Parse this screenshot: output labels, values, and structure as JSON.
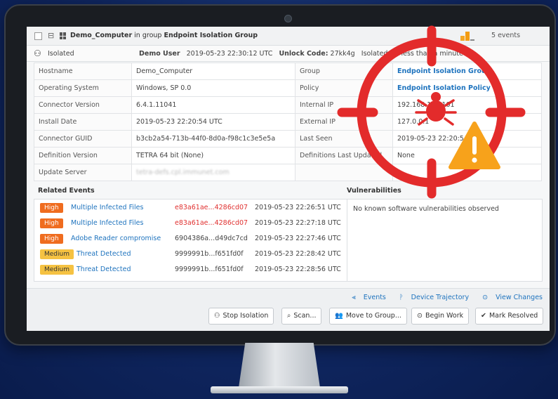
{
  "titlebar": {
    "computer_name": "Demo_Computer",
    "in_group_text": "in group",
    "group_name": "Endpoint Isolation Group",
    "events_count": "5 events"
  },
  "status": {
    "isolated_label": "Isolated",
    "user": "Demo User",
    "timestamp": "2019-05-23 22:30:12 UTC",
    "unlock_label": "Unlock Code:",
    "unlock_code": "27kk4g",
    "isolated_for": "Isolated for less than a minute"
  },
  "info_rows": [
    {
      "label": "Hostname",
      "value": "Demo_Computer",
      "label2": "Group",
      "value2": "Endpoint Isolation Group"
    },
    {
      "label": "Operating System",
      "value": "Windows, SP 0.0",
      "label2": "Policy",
      "value2": "Endpoint Isolation Policy"
    },
    {
      "label": "Connector Version",
      "value": "6.4.1.11041",
      "label2": "Internal IP",
      "value2": "192.168.100.101"
    },
    {
      "label": "Install Date",
      "value": "2019-05-23 22:20:54 UTC",
      "label2": "External IP",
      "value2": "127.0.0.1"
    },
    {
      "label": "Connector GUID",
      "value": "b3cb2a54-713b-44f0-8d0a-f98c1c3e5e5a",
      "label2": "Last Seen",
      "value2": "2019-05-23 22:20:54 UTC"
    },
    {
      "label": "Definition Version",
      "value": "TETRA 64 bit (None)",
      "label2": "Definitions Last Updated",
      "value2": "None"
    },
    {
      "label": "Update Server",
      "value": "tetra-defs.cpl.immunet.com",
      "label2": "",
      "value2": ""
    }
  ],
  "related_events": {
    "title": "Related Events",
    "rows": [
      {
        "severity": "High",
        "name": "Multiple Infected Files",
        "hash": "e83a61ae...4286cd07",
        "time": "2019-05-23 22:26:51 UTC"
      },
      {
        "severity": "High",
        "name": "Multiple Infected Files",
        "hash": "e83a61ae...4286cd07",
        "time": "2019-05-23 22:27:18 UTC"
      },
      {
        "severity": "High",
        "name": "Adobe Reader compromise",
        "hash": "6904386a...d49dc7cd",
        "time": "2019-05-23 22:27:46 UTC"
      },
      {
        "severity": "Medium",
        "name": "Threat Detected",
        "hash": "9999991b...f651fd0f",
        "time": "2019-05-23 22:28:42 UTC"
      },
      {
        "severity": "Medium",
        "name": "Threat Detected",
        "hash": "9999991b...f651fd0f",
        "time": "2019-05-23 22:28:56 UTC"
      }
    ]
  },
  "vulnerabilities": {
    "title": "Vulnerabilities",
    "message": "No known software vulnerabilities observed"
  },
  "footer_links": {
    "events": "Events",
    "trajectory": "Device Trajectory",
    "changes": "View Changes"
  },
  "buttons": {
    "stop_isolation": "Stop Isolation",
    "scan": "Scan...",
    "move_to_group": "Move to Group...",
    "begin_work": "Begin Work",
    "mark_resolved": "Mark Resolved"
  },
  "colors": {
    "target_red": "#e32b2b",
    "warning_amber": "#f7a21b",
    "link_blue": "#1e73be",
    "high_badge": "#ef6c1f",
    "medium_badge": "#f5c242",
    "hash_high_red": "#e0302f"
  },
  "overlay_icons": [
    "crosshair-icon",
    "bug-icon",
    "warning-icon"
  ]
}
